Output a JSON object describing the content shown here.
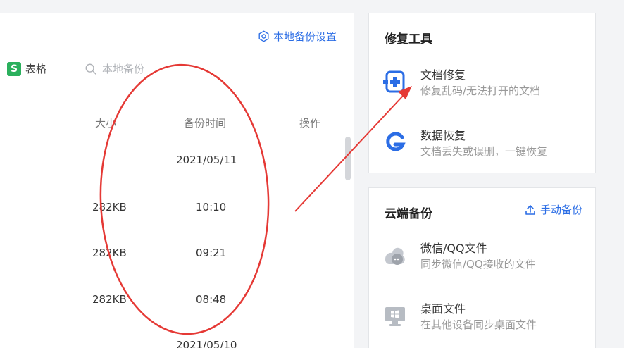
{
  "left": {
    "settings_label": "本地备份设置",
    "sheet_filter_label": "表格",
    "sheet_badge": "S",
    "search_placeholder": "本地备份",
    "columns": {
      "size": "大小",
      "time": "备份时间",
      "op": "操作"
    },
    "rows": [
      {
        "size": "",
        "time": "2021/05/11"
      },
      {
        "size": "282KB",
        "time": "10:10"
      },
      {
        "size": "282KB",
        "time": "09:21"
      },
      {
        "size": "282KB",
        "time": "08:48"
      },
      {
        "size": "",
        "time": "2021/05/10"
      }
    ]
  },
  "repair": {
    "title": "修复工具",
    "items": [
      {
        "title": "文档修复",
        "desc": "修复乱码/无法打开的文档",
        "icon": "doc-repair-icon"
      },
      {
        "title": "数据恢复",
        "desc": "文档丢失或误删，一键恢复",
        "icon": "data-recovery-icon"
      }
    ]
  },
  "cloud": {
    "title": "云端备份",
    "manual_label": "手动备份",
    "items": [
      {
        "title": "微信/QQ文件",
        "desc": "同步微信/QQ接收的文件",
        "icon": "chat-icon"
      },
      {
        "title": "桌面文件",
        "desc": "在其他设备同步桌面文件",
        "icon": "desktop-icon"
      }
    ]
  },
  "colors": {
    "accent": "#2b6de5",
    "annotation": "#e53935",
    "sheet_green": "#2bb05d"
  }
}
